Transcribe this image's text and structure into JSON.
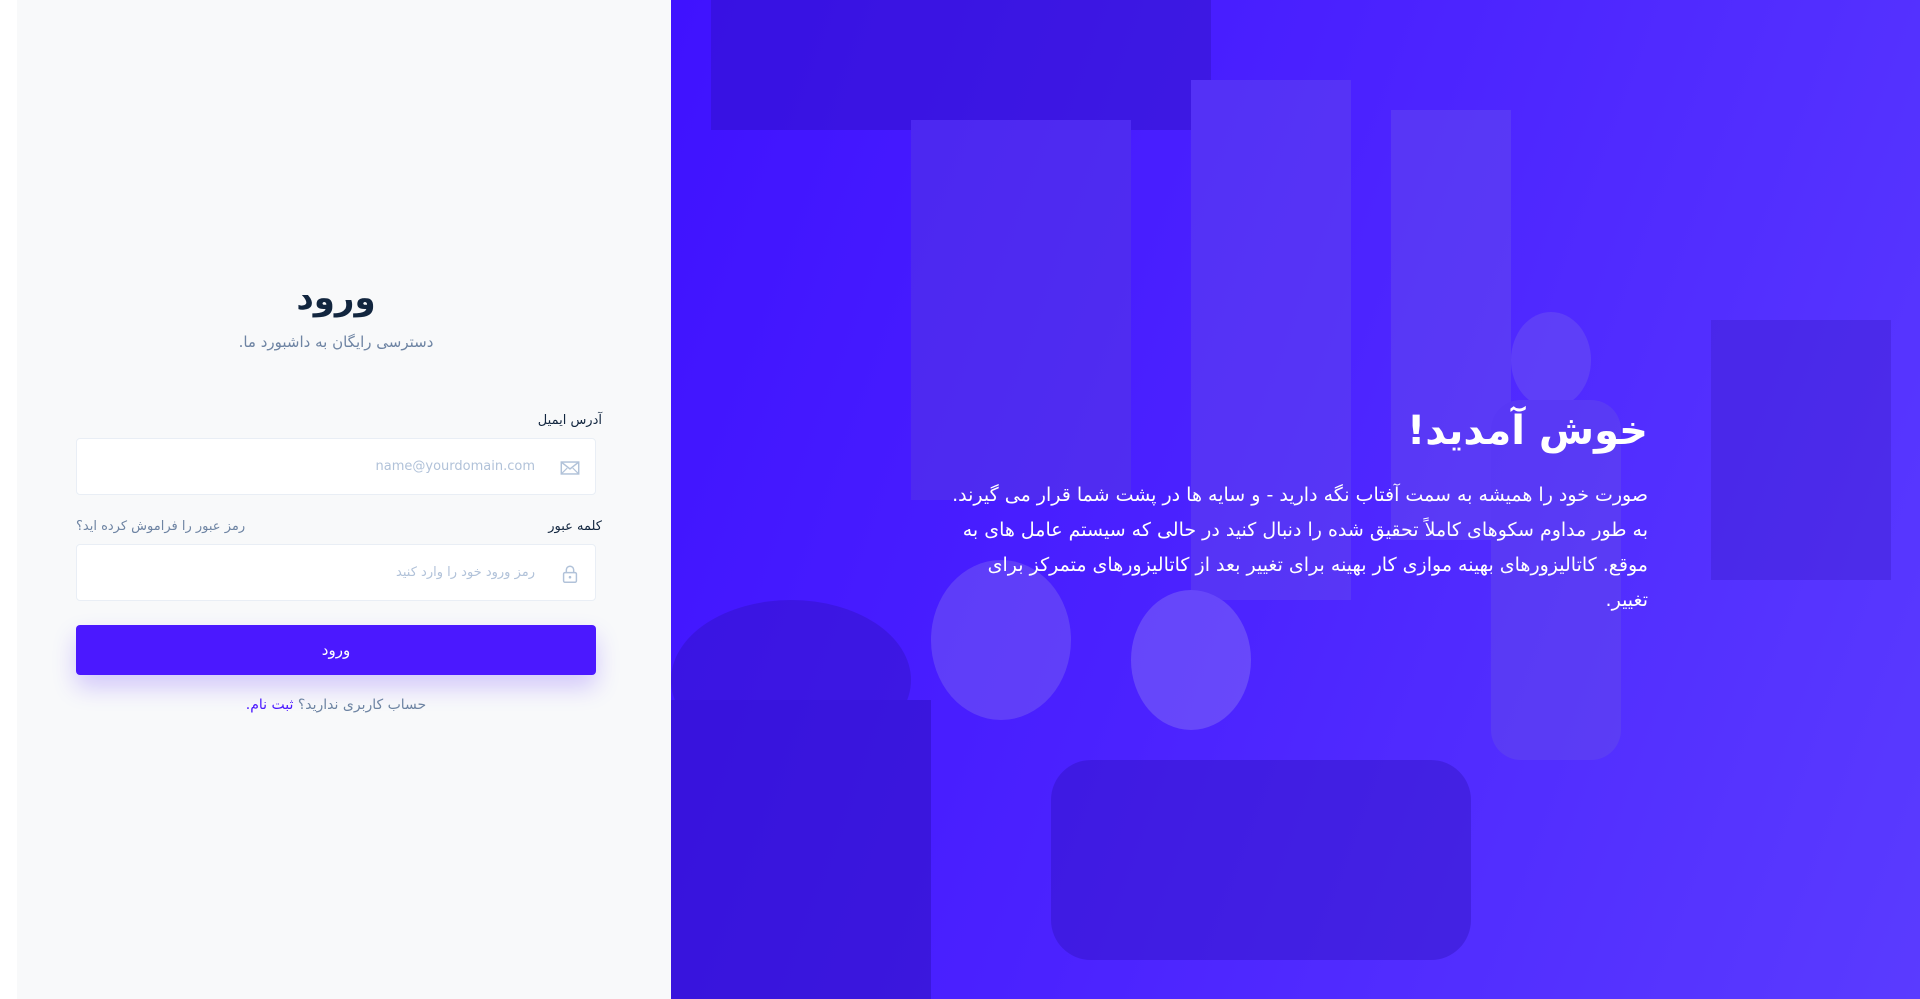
{
  "login": {
    "title": "ورود",
    "subtitle": "دسترسی رایگان به داشبورد ما.",
    "email_label": "آدرس ایمیل",
    "email_placeholder": "name@yourdomain.com",
    "email_value": "",
    "password_label": "کلمه عبور",
    "password_placeholder": "رمز ورود خود را وارد کنید",
    "password_value": "",
    "forgot_link": "رمز عبور را فراموش کرده اید؟",
    "submit_label": "ورود",
    "signup_prompt": "حساب کاربری ندارید؟",
    "signup_link": "ثبت نام."
  },
  "hero": {
    "title": "خوش آمدید!",
    "text": "صورت خود را همیشه به سمت آفتاب نگه دارید - و سایه ها در پشت شما قرار می گیرند. به طور مداوم سکوهای کاملاً تحقیق شده را دنبال کنید در حالی که سیستم عامل های به موقع. کاتالیزورهای بهینه موازی کار بهینه برای تغییر بعد از کاتالیزورهای متمرکز برای تغییر."
  },
  "icons": {
    "email_icon": "envelope-icon",
    "password_icon": "lock-icon"
  },
  "colors": {
    "primary": "#4b18ff",
    "hero_overlay": "#4b22ff",
    "panel_bg": "#f8f9fa",
    "muted_text": "#6e84a3"
  }
}
